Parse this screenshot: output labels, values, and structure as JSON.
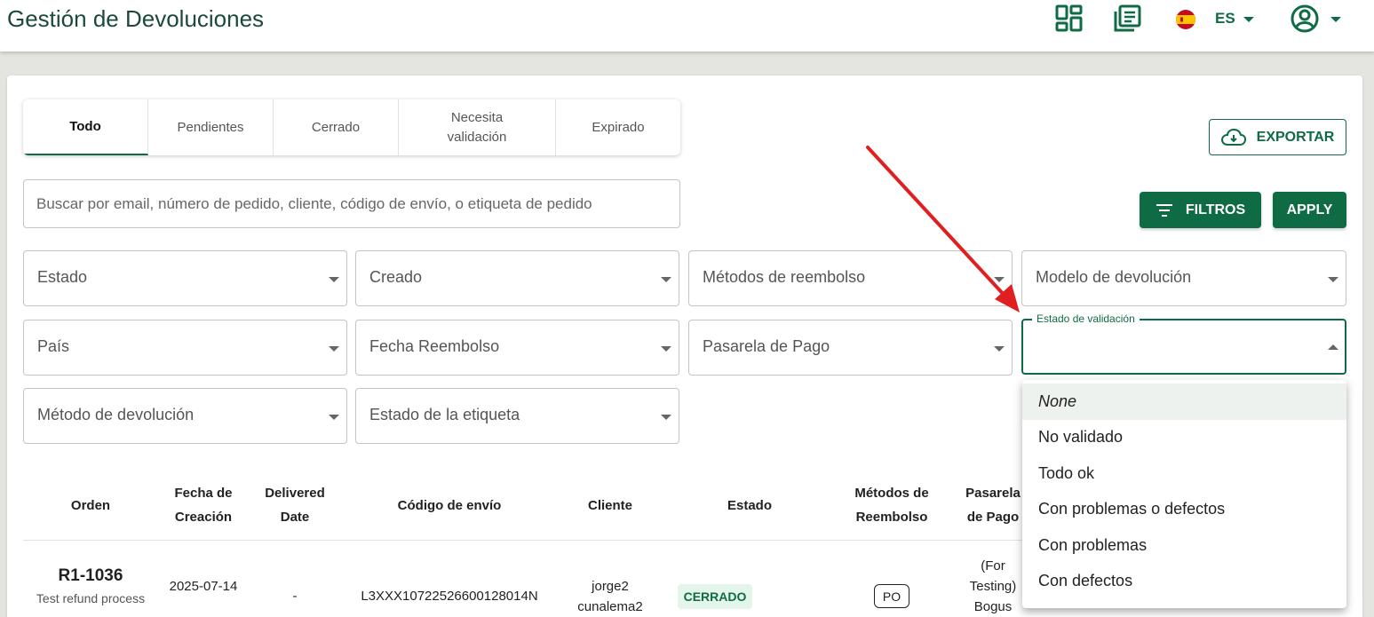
{
  "header": {
    "title": "Gestión de Devoluciones",
    "language": "ES"
  },
  "tabs": [
    {
      "label": "Todo",
      "active": true
    },
    {
      "label": "Pendientes"
    },
    {
      "label": "Cerrado"
    },
    {
      "label": "Necesita validación"
    },
    {
      "label": "Expirado"
    }
  ],
  "toolbar": {
    "export_label": "EXPORTAR",
    "filters_label": "FILTROS",
    "apply_label": "APPLY"
  },
  "search": {
    "placeholder": "Buscar por email, número de pedido, cliente, código de envío, o etiqueta de pedido"
  },
  "filters": {
    "estado": "Estado",
    "creado": "Creado",
    "metodos_reembolso": "Métodos de reembolso",
    "modelo_devolucion": "Modelo de devolución",
    "pais": "País",
    "fecha_reembolso": "Fecha Reembolso",
    "pasarela_pago": "Pasarela de Pago",
    "estado_validacion": "Estado de validación",
    "metodo_devolucion": "Método de devolución",
    "estado_etiqueta": "Estado de la etiqueta"
  },
  "validation_menu": {
    "options": [
      "None",
      "No validado",
      "Todo ok",
      "Con problemas o defectos",
      "Con problemas",
      "Con defectos"
    ],
    "highlighted": "None"
  },
  "table": {
    "columns": [
      "Orden",
      "Fecha de Creación",
      "Delivered Date",
      "Código de envío",
      "Cliente",
      "Estado",
      "Métodos de Reembolso",
      "Pasarela de Pago"
    ],
    "rows": [
      {
        "order": "R1-1036",
        "order_note": "Test refund process",
        "created": "2025-07-14",
        "delivered": "-",
        "shipping_code": "L3XXX10722526600128014N",
        "client": "jorge2 cunalema2",
        "status": "CERRADO",
        "refund_method": "PO",
        "gateway": "(For Testing) Bogus Gateway"
      }
    ]
  },
  "colors": {
    "primary": "#0f6b44",
    "title": "#1c4a3a",
    "badge_bg": "#e4f5ea",
    "annotation_arrow": "#e02020"
  }
}
